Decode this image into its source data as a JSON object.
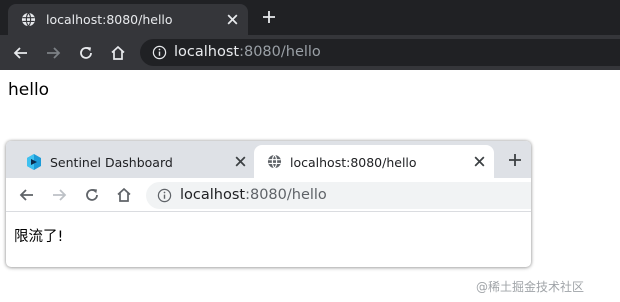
{
  "top_browser": {
    "tab": {
      "title": "localhost:8080/hello",
      "icon": "globe-icon"
    },
    "new_tab_icon": "plus-icon",
    "toolbar": {
      "back_icon": "arrow-left-icon",
      "forward_icon": "arrow-right-icon",
      "reload_icon": "reload-icon",
      "home_icon": "home-icon"
    },
    "address": {
      "host": "localhost",
      "rest": ":8080/hello",
      "info_icon": "info-icon"
    },
    "page_text": "hello",
    "colors": {
      "tabstrip": "#202124",
      "tab": "#35363a",
      "text": "#e8eaed",
      "dim_text": "#9aa0a6"
    }
  },
  "bottom_browser": {
    "tabs": [
      {
        "title": "Sentinel Dashboard",
        "icon": "sentinel-logo-icon",
        "active": false
      },
      {
        "title": "localhost:8080/hello",
        "icon": "globe-icon",
        "active": true
      }
    ],
    "new_tab_icon": "plus-icon",
    "toolbar": {
      "back_icon": "arrow-left-icon",
      "forward_icon": "arrow-right-icon",
      "reload_icon": "reload-icon",
      "home_icon": "home-icon"
    },
    "address": {
      "host": "localhost",
      "rest": ":8080/hello",
      "info_icon": "info-icon"
    },
    "page_text": "限流了!",
    "colors": {
      "tabstrip": "#dee1e6",
      "tab": "#ffffff",
      "omnibox": "#f1f3f4",
      "text": "#202124"
    }
  },
  "watermark": "@稀土掘金技术社区"
}
